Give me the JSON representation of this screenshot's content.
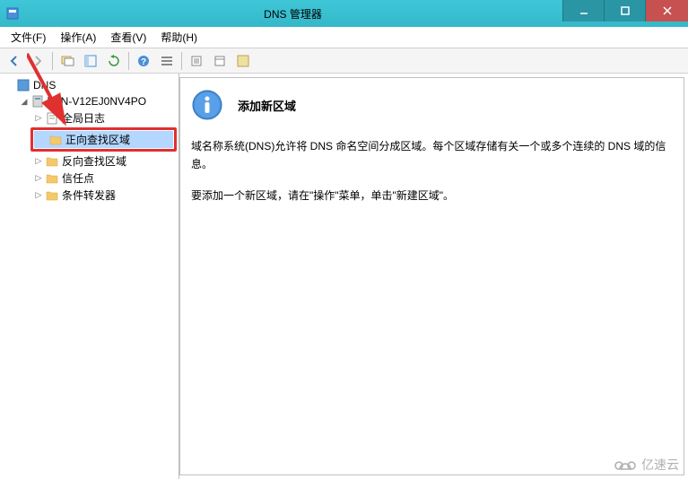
{
  "titlebar": {
    "title": "DNS 管理器"
  },
  "menubar": {
    "file": "文件(F)",
    "action": "操作(A)",
    "view": "查看(V)",
    "help": "帮助(H)"
  },
  "tree": {
    "root": "DNS",
    "server": "WIN-V12EJ0NV4PO",
    "global_log": "全局日志",
    "forward_zone": "正向查找区域",
    "reverse_zone": "反向查找区域",
    "trust_point": "信任点",
    "conditional_fwd": "条件转发器"
  },
  "detail": {
    "heading": "添加新区域",
    "para1": "域名称系统(DNS)允许将 DNS 命名空间分成区域。每个区域存储有关一个或多个连续的 DNS 域的信息。",
    "para2": "要添加一个新区域，请在\"操作\"菜单，单击\"新建区域\"。"
  },
  "watermark": {
    "text": "亿速云"
  }
}
